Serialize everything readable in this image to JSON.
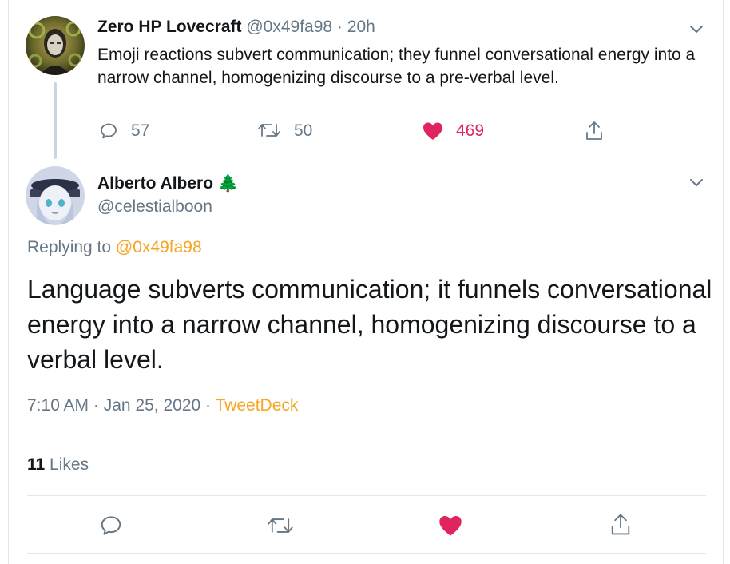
{
  "parent_tweet": {
    "display_name": "Zero HP Lovecraft",
    "handle": "@0x49fa98",
    "separator": "·",
    "time_ago": "20h",
    "text": "Emoji reactions subvert communication; they funnel conversational energy into a narrow channel, homogenizing discourse to a pre-verbal level.",
    "actions": {
      "reply_count": "57",
      "retweet_count": "50",
      "like_count": "469"
    }
  },
  "main_tweet": {
    "display_name": "Alberto Albero",
    "name_emoji": "🌲",
    "handle": "@celestialboon",
    "replying_to_prefix": "Replying to",
    "replying_to_handle": "@0x49fa98",
    "text": "Language subverts communication; it funnels conversational energy into a narrow channel, homogenizing discourse to a verbal level.",
    "time": "7:10 AM",
    "separator1": "·",
    "date": "Jan 25, 2020",
    "separator2": "·",
    "source": "TweetDeck",
    "likes_count": "11",
    "likes_label": "Likes"
  },
  "colors": {
    "accent": "#f5a623",
    "like_red": "#e0245e",
    "muted": "#657786",
    "divider": "#e1e8ed"
  },
  "icons": [
    "reply-icon",
    "retweet-icon",
    "heart-icon",
    "share-icon",
    "chevron-down-icon"
  ]
}
